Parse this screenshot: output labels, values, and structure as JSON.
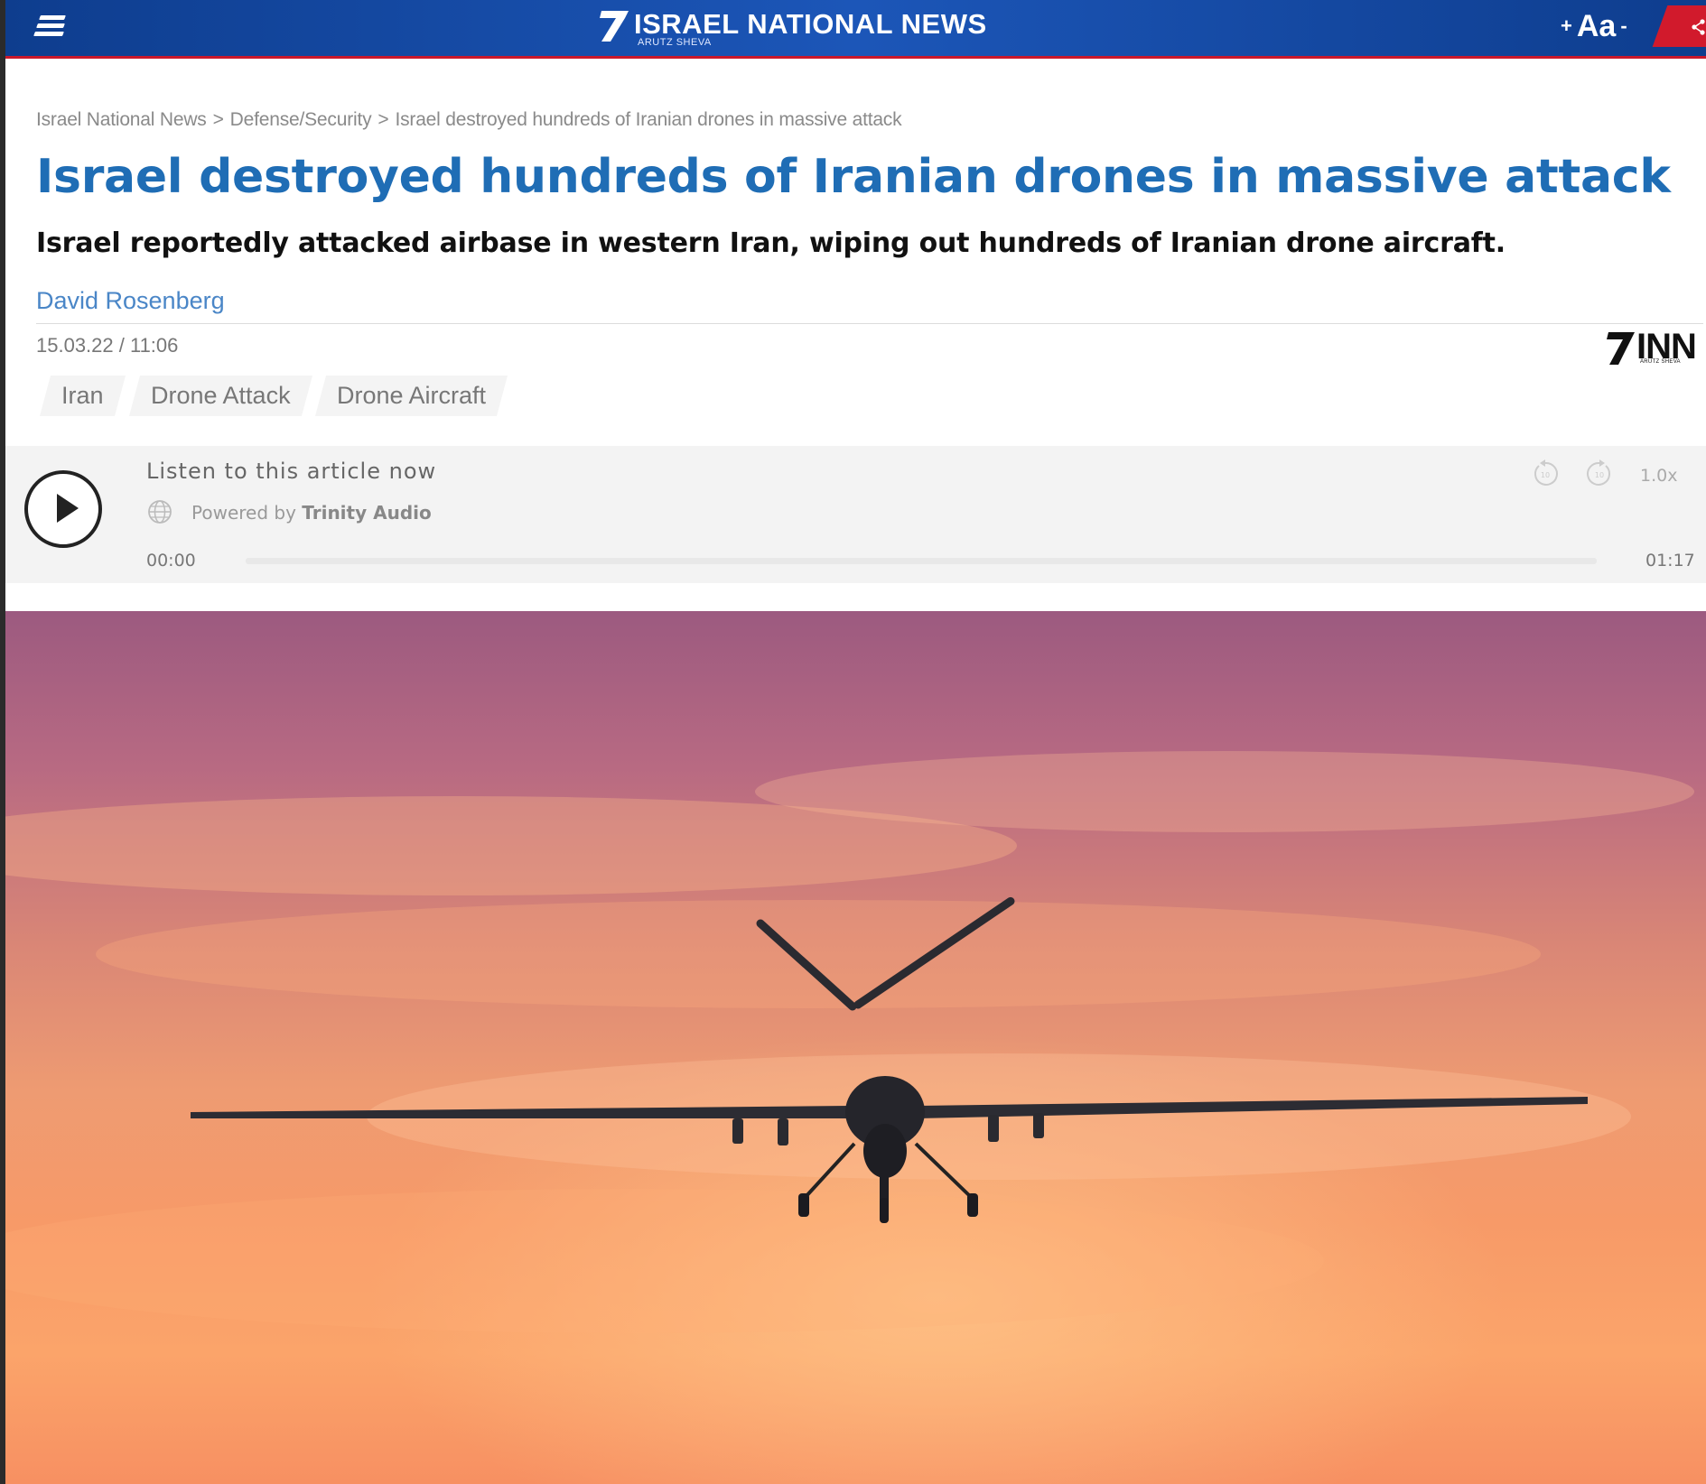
{
  "site": {
    "logo_title": "ISRAEL NATIONAL NEWS",
    "logo_subtitle": "ARUTZ SHEVA",
    "font_increase": "+",
    "font_label": "Aa",
    "font_decrease": "-",
    "brand_blue": "#1c56b8",
    "brand_red": "#d11a2c"
  },
  "breadcrumb": {
    "items": [
      "Israel National News",
      "Defense/Security",
      "Israel destroyed hundreds of Iranian drones in massive attack"
    ],
    "separator": ">"
  },
  "article": {
    "headline": "Israel destroyed hundreds of Iranian drones in massive attack",
    "subheadline": "Israel reportedly attacked airbase in western Iran, wiping out hundreds of Iranian drone aircraft.",
    "author": "David Rosenberg",
    "date": "15.03.22 / 11:06",
    "inn_logo": "INN",
    "inn_logo_sub": "ARUTZ SHEVA",
    "tags": [
      "Iran",
      "Drone Attack",
      "Drone Aircraft"
    ]
  },
  "player": {
    "listen_label": "Listen to this article now",
    "powered_prefix": "Powered by",
    "powered_brand": "Trinity Audio",
    "current_time": "00:00",
    "total_time": "01:17",
    "speed": "1.0x",
    "progress": 0
  },
  "hero_image": {
    "subject": "drone silhouette against sunset sky"
  }
}
